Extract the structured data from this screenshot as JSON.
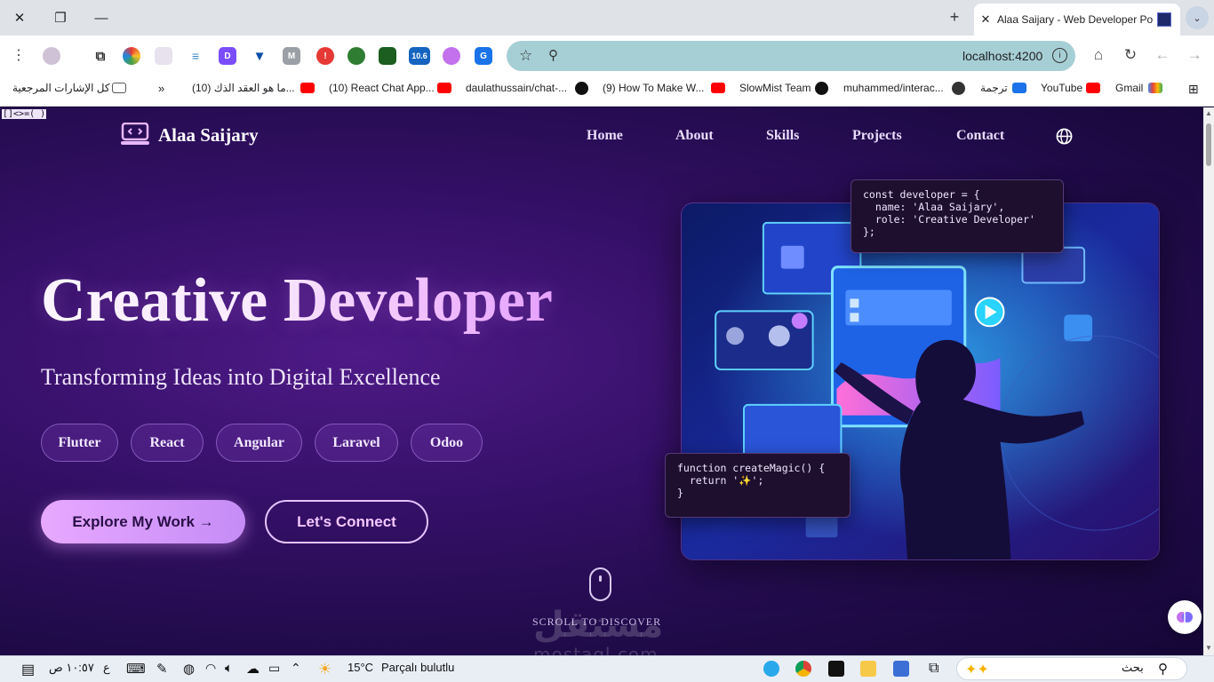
{
  "browser": {
    "tab_title": "Alaa Saijary - Web Developer Po",
    "url": "localhost:4200",
    "window_controls": {
      "close": "✕",
      "restore": "❐",
      "minimize": "—"
    },
    "bookmarks": [
      "كل الإشارات المرجعية",
      "»",
      "(10) ما هو العقد الذك...",
      "(10) React Chat App...",
      "daulathussain/chat-...",
      "(9) How To Make W...",
      "SlowMist Team",
      "muhammed/interac...",
      "ترجمة",
      "YouTube",
      "Gmail"
    ],
    "extension_badge": "10.6"
  },
  "page": {
    "glitch_text": "[]<>=( )",
    "logo": "Alaa Saijary",
    "nav": [
      "Home",
      "About",
      "Skills",
      "Projects",
      "Contact"
    ],
    "hero_title": "Creative Developer",
    "hero_subtitle": "Transforming Ideas into Digital Excellence",
    "tech_chips": [
      "Flutter",
      "React",
      "Angular",
      "Laravel",
      "Odoo"
    ],
    "cta_primary": "Explore My Work →",
    "cta_secondary": "Let's Connect",
    "scroll_hint": "SCROLL TO DISCOVER",
    "code_top": "const developer = {\n  name: 'Alaa Saijary',\n  role: 'Creative Developer'\n};",
    "code_bottom": "function createMagic() {\n  return '✨';\n}",
    "watermark": "مستقل",
    "watermark_sub": "mostaql.com"
  },
  "taskbar": {
    "time": "١٠:٥٧ ص",
    "lang": "ع",
    "weather_temp": "15°C",
    "weather_desc": "Parçalı bulutlu",
    "search_placeholder": "بحث"
  },
  "colors": {
    "bg_deep": "#1b0b3a",
    "bg_mid": "#4e1a86",
    "accent": "#e7a8ff",
    "omnibox": "#a6cfd5"
  }
}
